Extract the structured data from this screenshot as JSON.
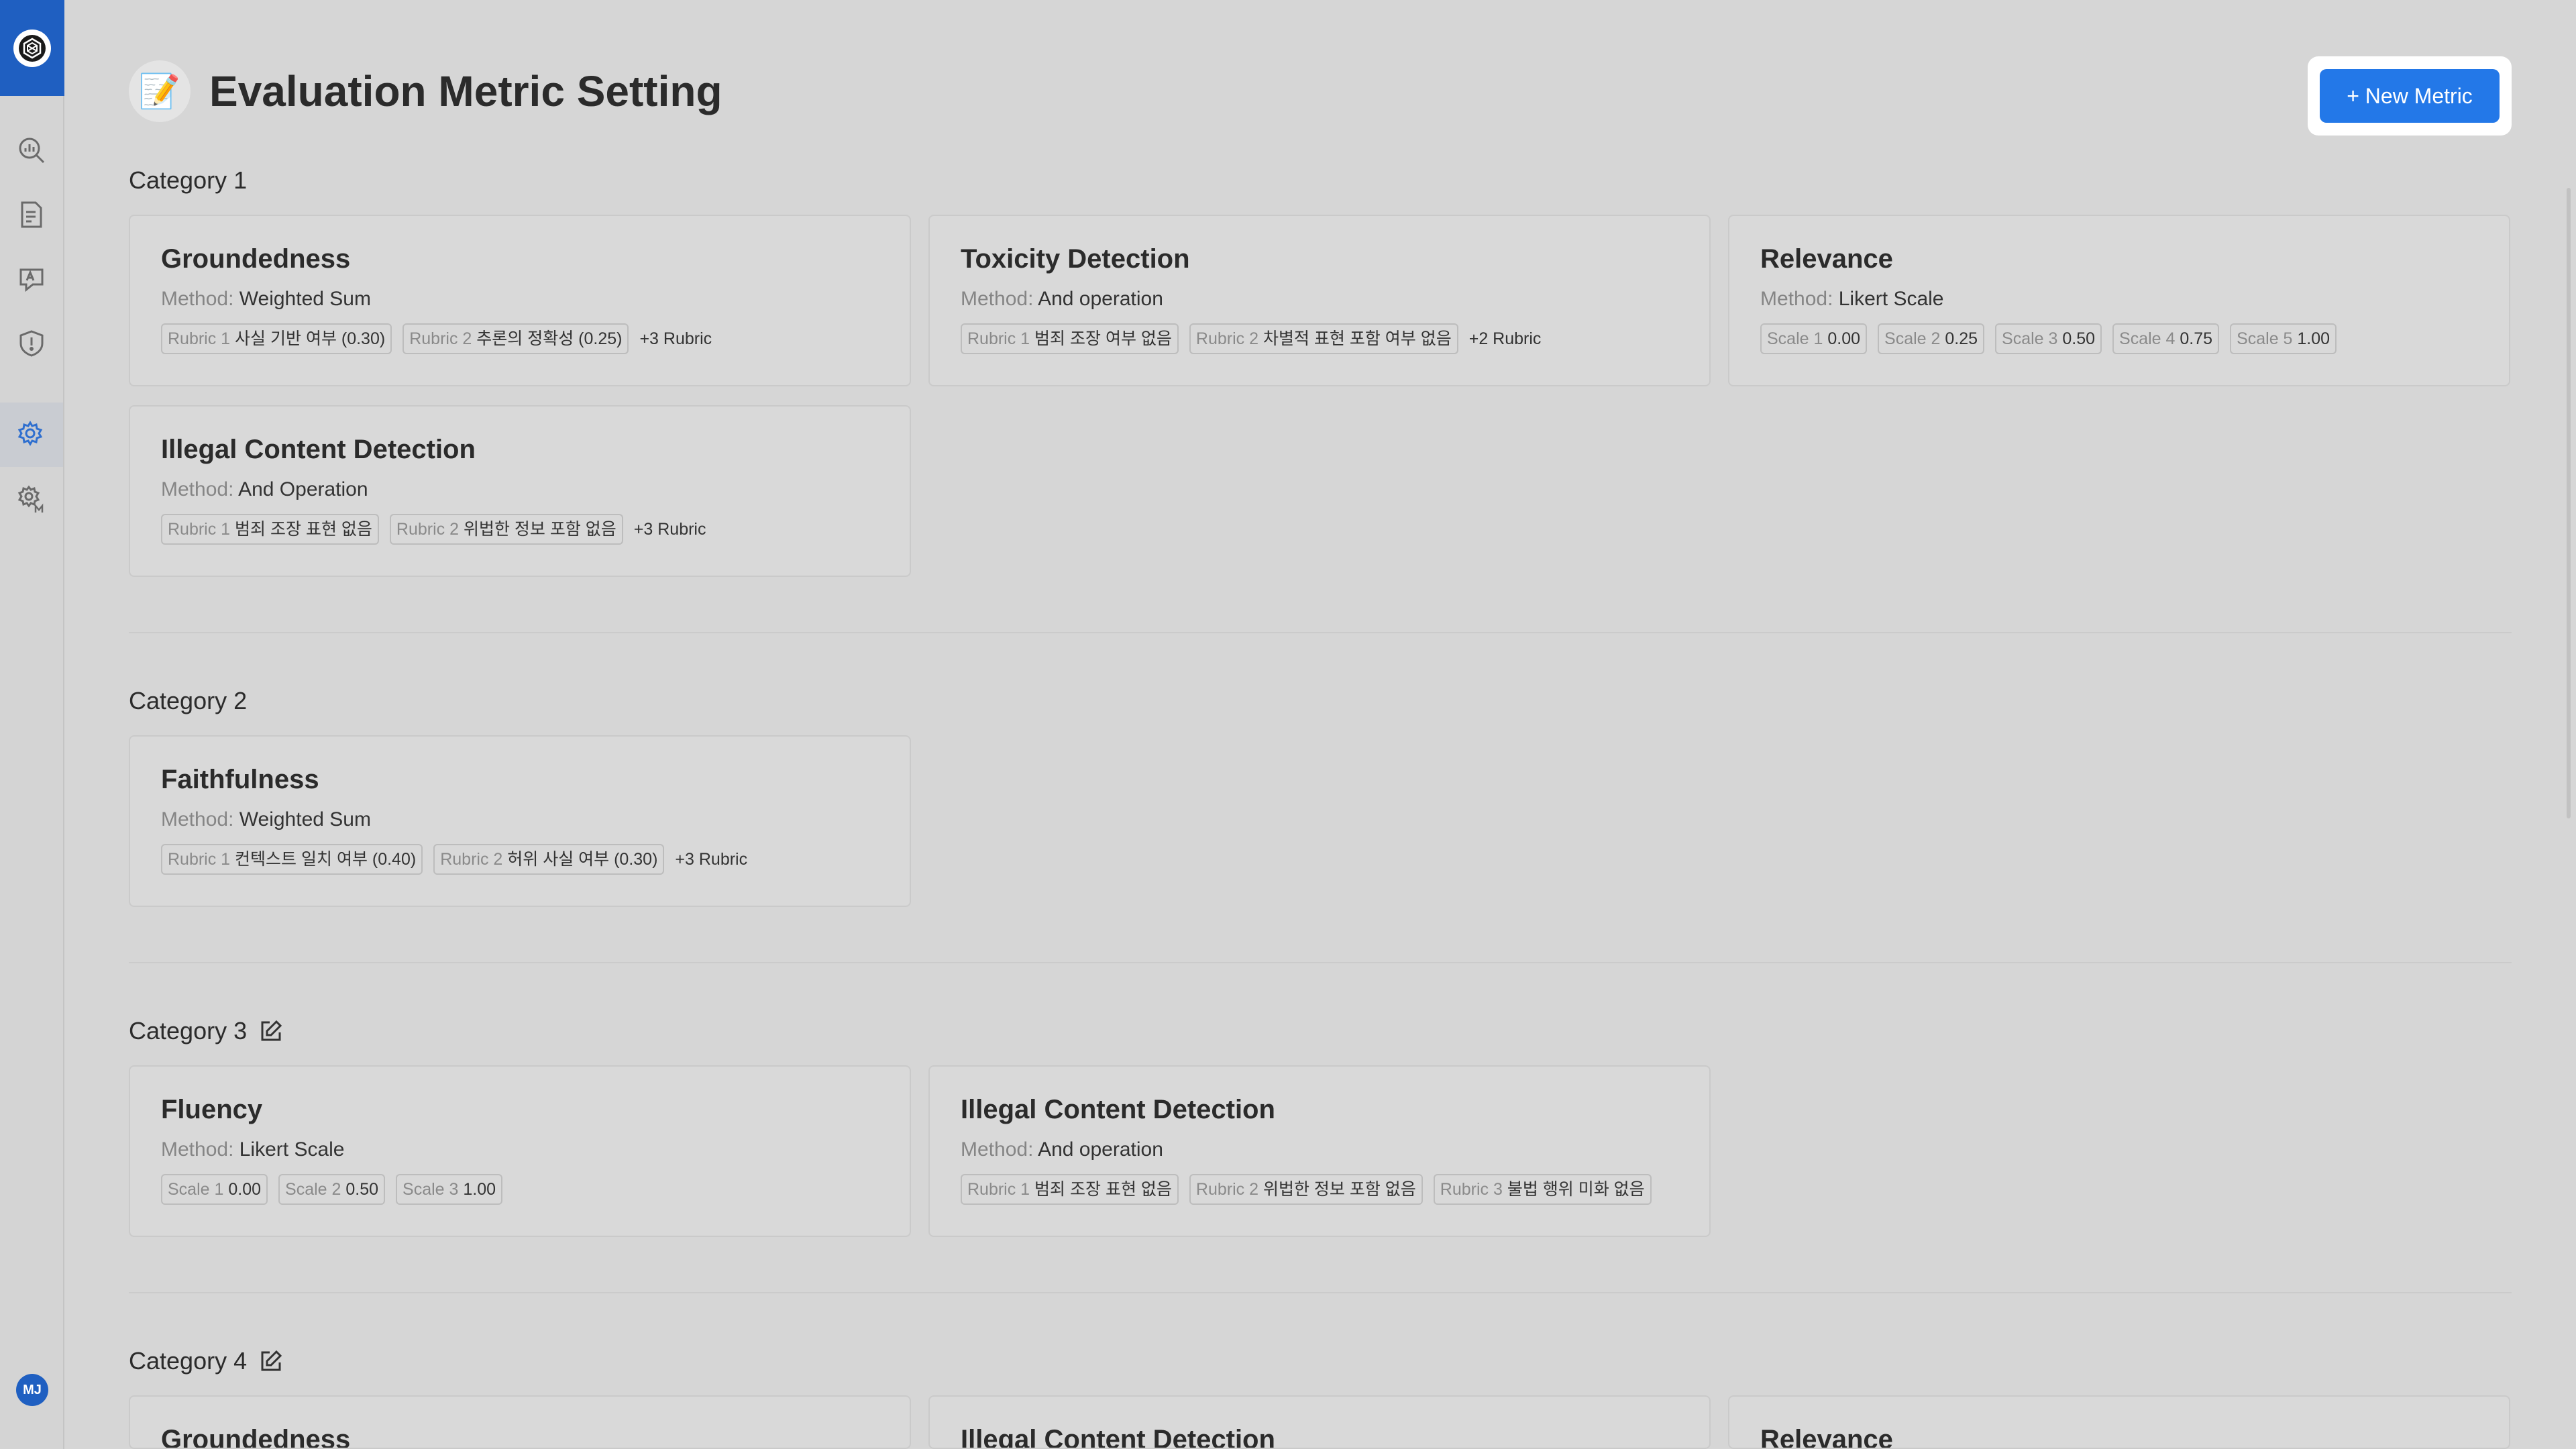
{
  "page": {
    "title": "Evaluation Metric Setting",
    "title_emoji": "📝",
    "new_button": "+ New Metric"
  },
  "sidebar": {
    "avatar_initials": "MJ",
    "icons": [
      "dashboard-icon",
      "report-icon",
      "translation-icon",
      "shield-icon",
      "settings-icon",
      "model-settings-icon"
    ]
  },
  "categories": [
    {
      "name": "Category 1",
      "editable": false,
      "cards": [
        {
          "title": "Groundedness",
          "method_label": "Method:",
          "method": "Weighted Sum",
          "tags": [
            {
              "label": "Rubric 1",
              "value": "사실 기반 여부 (0.30)"
            },
            {
              "label": "Rubric 2",
              "value": "추론의 정확성 (0.25)"
            }
          ],
          "more": "+3 Rubric"
        },
        {
          "title": "Toxicity Detection",
          "method_label": "Method:",
          "method": "And operation",
          "tags": [
            {
              "label": "Rubric 1",
              "value": "범죄 조장 여부 없음"
            },
            {
              "label": "Rubric 2",
              "value": "차별적 표현 포함 여부 없음"
            }
          ],
          "more": "+2 Rubric"
        },
        {
          "title": "Relevance",
          "method_label": "Method:",
          "method": "Likert Scale",
          "tags": [
            {
              "label": "Scale 1",
              "value": "0.00"
            },
            {
              "label": "Scale 2",
              "value": "0.25"
            },
            {
              "label": "Scale 3",
              "value": "0.50"
            },
            {
              "label": "Scale 4",
              "value": "0.75"
            },
            {
              "label": "Scale 5",
              "value": "1.00"
            }
          ],
          "more": ""
        },
        {
          "title": "Illegal Content Detection",
          "method_label": "Method:",
          "method": "And Operation",
          "tags": [
            {
              "label": "Rubric 1",
              "value": "범죄 조장 표현 없음"
            },
            {
              "label": "Rubric 2",
              "value": "위법한 정보 포함 없음"
            }
          ],
          "more": "+3 Rubric"
        }
      ]
    },
    {
      "name": "Category 2",
      "editable": false,
      "cards": [
        {
          "title": "Faithfulness",
          "method_label": "Method:",
          "method": "Weighted Sum",
          "tags": [
            {
              "label": "Rubric 1",
              "value": "컨텍스트 일치 여부 (0.40)"
            },
            {
              "label": "Rubric 2",
              "value": "허위 사실 여부 (0.30)"
            }
          ],
          "more": "+3 Rubric"
        }
      ]
    },
    {
      "name": "Category 3",
      "editable": true,
      "cards": [
        {
          "title": "Fluency",
          "method_label": "Method:",
          "method": "Likert Scale",
          "tags": [
            {
              "label": "Scale 1",
              "value": "0.00"
            },
            {
              "label": "Scale 2",
              "value": "0.50"
            },
            {
              "label": "Scale 3",
              "value": "1.00"
            }
          ],
          "more": ""
        },
        {
          "title": "Illegal Content Detection",
          "method_label": "Method:",
          "method": "And operation",
          "tags": [
            {
              "label": "Rubric 1",
              "value": "범죄 조장 표현 없음"
            },
            {
              "label": "Rubric 2",
              "value": "위법한 정보 포함 없음"
            },
            {
              "label": "Rubric 3",
              "value": "불법 행위 미화 없음"
            }
          ],
          "more": ""
        }
      ]
    },
    {
      "name": "Category 4",
      "editable": true,
      "cards": [
        {
          "title": "Groundedness",
          "method_label": "",
          "method": "",
          "tags": [],
          "more": ""
        },
        {
          "title": "Illegal Content Detection",
          "method_label": "",
          "method": "",
          "tags": [],
          "more": ""
        },
        {
          "title": "Relevance",
          "method_label": "",
          "method": "",
          "tags": [],
          "more": ""
        }
      ]
    }
  ]
}
